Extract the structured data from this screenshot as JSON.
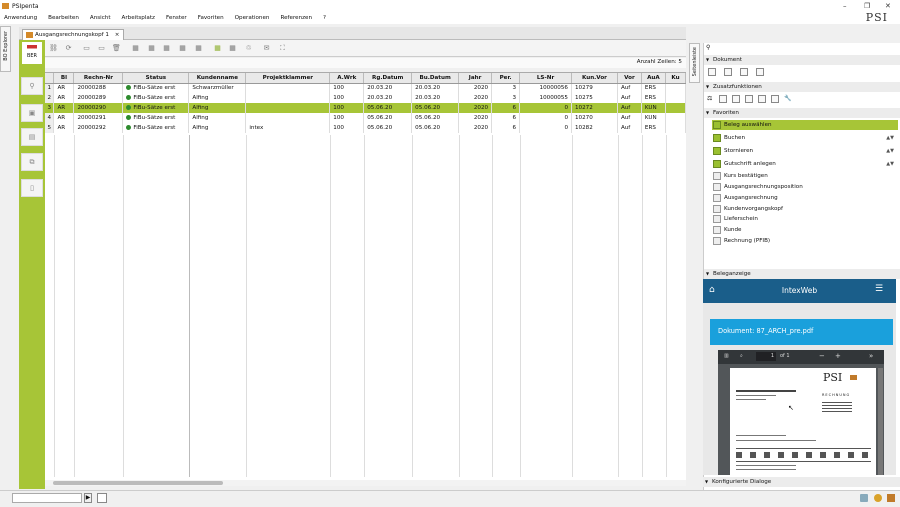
{
  "app": {
    "title": "PSIpenta",
    "logo_text": "PSI"
  },
  "menu": [
    "Anwendung",
    "Bearbeiten",
    "Ansicht",
    "Arbeitsplatz",
    "Fenster",
    "Favoriten",
    "Operationen",
    "Referenzen",
    "?"
  ],
  "left_strip": {
    "label": "BO Explorer"
  },
  "tab": {
    "label": "Ausgangsrechnungskopf 1"
  },
  "ber": {
    "label": "BER"
  },
  "anzahl": "Anzahl Zeilen: 5",
  "grid": {
    "columns": [
      "Bl",
      "Rechn-Nr",
      "Status",
      "Kundenname",
      "Projektklammer",
      "A.Wrk",
      "Rg.Datum",
      "Bu.Datum",
      "Jahr",
      "Per.",
      "LS-Nr",
      "Kun.Vor",
      "Vor",
      "AuA",
      "Ku"
    ],
    "rows": [
      {
        "n": "1",
        "bl": "AR",
        "nr": "20000288",
        "status": "FiBu-Sätze erst",
        "kunde": "Schwarzmüller",
        "projekt": "",
        "wrk": "100",
        "rg": "20.03.20",
        "bu": "20.03.20",
        "jahr": "2020",
        "per": "3",
        "ls": "10000056",
        "kv": "10279",
        "vor": "Auf",
        "aua": "ERS",
        "ku": ""
      },
      {
        "n": "2",
        "bl": "AR",
        "nr": "20000289",
        "status": "FiBu-Sätze erst",
        "kunde": "Alfing",
        "projekt": "",
        "wrk": "100",
        "rg": "20.03.20",
        "bu": "20.03.20",
        "jahr": "2020",
        "per": "3",
        "ls": "10000055",
        "kv": "10275",
        "vor": "Auf",
        "aua": "ERS",
        "ku": ""
      },
      {
        "n": "3",
        "bl": "AR",
        "nr": "20000290",
        "status": "FiBu-Sätze erst",
        "kunde": "Alfing",
        "projekt": "",
        "wrk": "100",
        "rg": "05.06.20",
        "bu": "05.06.20",
        "jahr": "2020",
        "per": "6",
        "ls": "0",
        "kv": "10272",
        "vor": "Auf",
        "aua": "KUN",
        "ku": ""
      },
      {
        "n": "4",
        "bl": "AR",
        "nr": "20000291",
        "status": "FiBu-Sätze erst",
        "kunde": "Alfing",
        "projekt": "",
        "wrk": "100",
        "rg": "05.06.20",
        "bu": "05.06.20",
        "jahr": "2020",
        "per": "6",
        "ls": "0",
        "kv": "10270",
        "vor": "Auf",
        "aua": "KUN",
        "ku": ""
      },
      {
        "n": "5",
        "bl": "AR",
        "nr": "20000292",
        "status": "FiBu-Sätze erst",
        "kunde": "Alfing",
        "projekt": "intex",
        "wrk": "100",
        "rg": "05.06.20",
        "bu": "05.06.20",
        "jahr": "2020",
        "per": "6",
        "ls": "0",
        "kv": "10282",
        "vor": "Auf",
        "aua": "ERS",
        "ku": ""
      }
    ],
    "selected_row": 2
  },
  "right": {
    "seitenleiste": "Seitenleiste",
    "dokument": "Dokument",
    "zusatz": "Zusatzfunktionen",
    "favoriten": "Favoriten",
    "fav_items": [
      "Beleg auswählen",
      "Buchen",
      "Stornieren",
      "Gutschrift anlegen",
      "Kurs bestätigen",
      "Ausgangsrechnungsposition",
      "Ausgangsrechnung",
      "Kundenvorgangskopf",
      "Lieferschein",
      "Kunde",
      "Rechnung (PFIB)"
    ],
    "beleganzeige": "Beleganzeige",
    "intexweb": "IntexWeb",
    "doc_title": "Dokument: 87_ARCH_pre.pdf",
    "pdf_page": "1",
    "pdf_of": "of 1",
    "pdf_logo": "PSI",
    "pdf_heading": "RECHNUNG",
    "konfig": "Konfigurierte Dialoge"
  },
  "colors": {
    "accent": "#a7c537",
    "intex": "#1a5e8a",
    "doc": "#1aa0dc"
  }
}
